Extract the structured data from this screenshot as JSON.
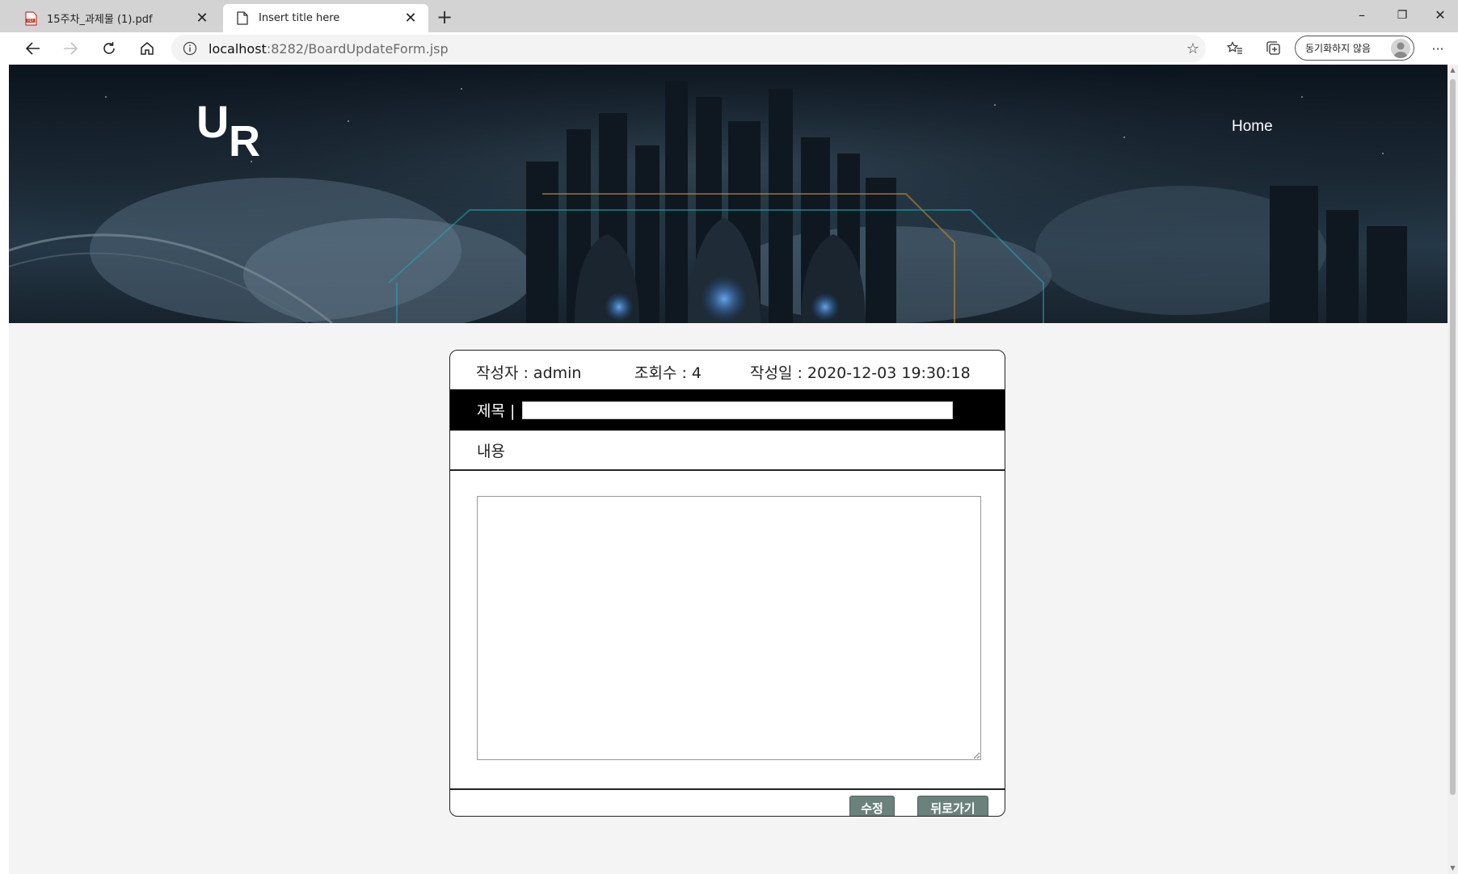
{
  "browser": {
    "tabs": [
      {
        "title": "15주차_과제물 (1).pdf",
        "icon": "pdf-icon",
        "active": false
      },
      {
        "title": "Insert title here",
        "icon": "page-icon",
        "active": true
      }
    ],
    "new_tab_label": "+",
    "url": {
      "host": "localhost",
      "path": ":8282/BoardUpdateForm.jsp"
    },
    "profile_label": "동기화하지 않음",
    "window_controls": {
      "minimize": "–",
      "restore": "❐",
      "close": "✕"
    },
    "more_label": "···"
  },
  "site": {
    "logo_u": "U",
    "logo_r": "R",
    "nav_home": "Home"
  },
  "form": {
    "writer": "작성자 : admin",
    "views": "조회수 : 4",
    "date": "작성일 : 2020-12-03 19:30:18",
    "title_label": "제목 |",
    "title_value": "",
    "content_label": "내용",
    "content_value": "",
    "submit_label": "수정",
    "back_label": "뒤로가기"
  },
  "colors": {
    "button": "#6a817c",
    "title_bar": "#000000",
    "page_bg": "#f5f4f4"
  }
}
